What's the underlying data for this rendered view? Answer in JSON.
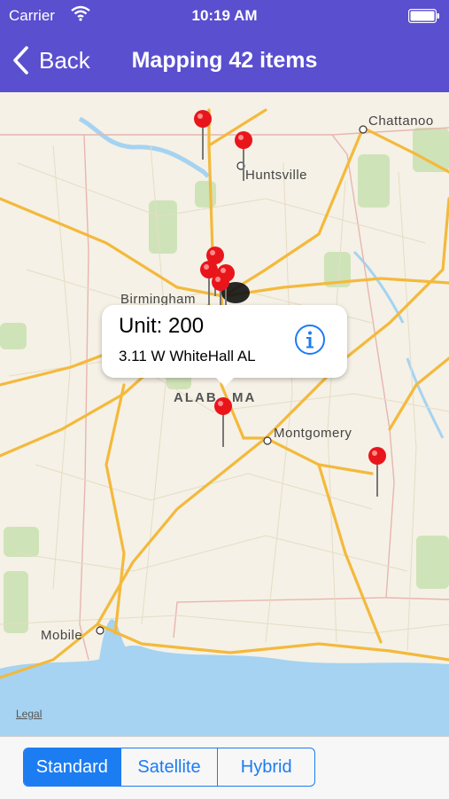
{
  "status_bar": {
    "carrier": "Carrier",
    "time": "10:19 AM"
  },
  "nav": {
    "back_label": "Back",
    "title": "Mapping 42 items"
  },
  "map": {
    "cities": {
      "chattanooga": "Chattanoo",
      "huntsville": "Huntsville",
      "birmingham": "Birmingham",
      "montgomery": "Montgomery",
      "mobile": "Mobile"
    },
    "state_label_left": "ALAB",
    "state_label_right": "MA",
    "legal": "Legal",
    "callout": {
      "title": "Unit: 200",
      "subtitle": "3.11 W WhiteHall AL"
    }
  },
  "map_type": {
    "options": [
      "Standard",
      "Satellite",
      "Hybrid"
    ],
    "selected": "Standard"
  },
  "colors": {
    "nav_bg": "#5a4fcf",
    "accent": "#1c7cf2",
    "pin": "#e8161b",
    "road": "#f4b93c",
    "water": "#9fd0f0"
  }
}
